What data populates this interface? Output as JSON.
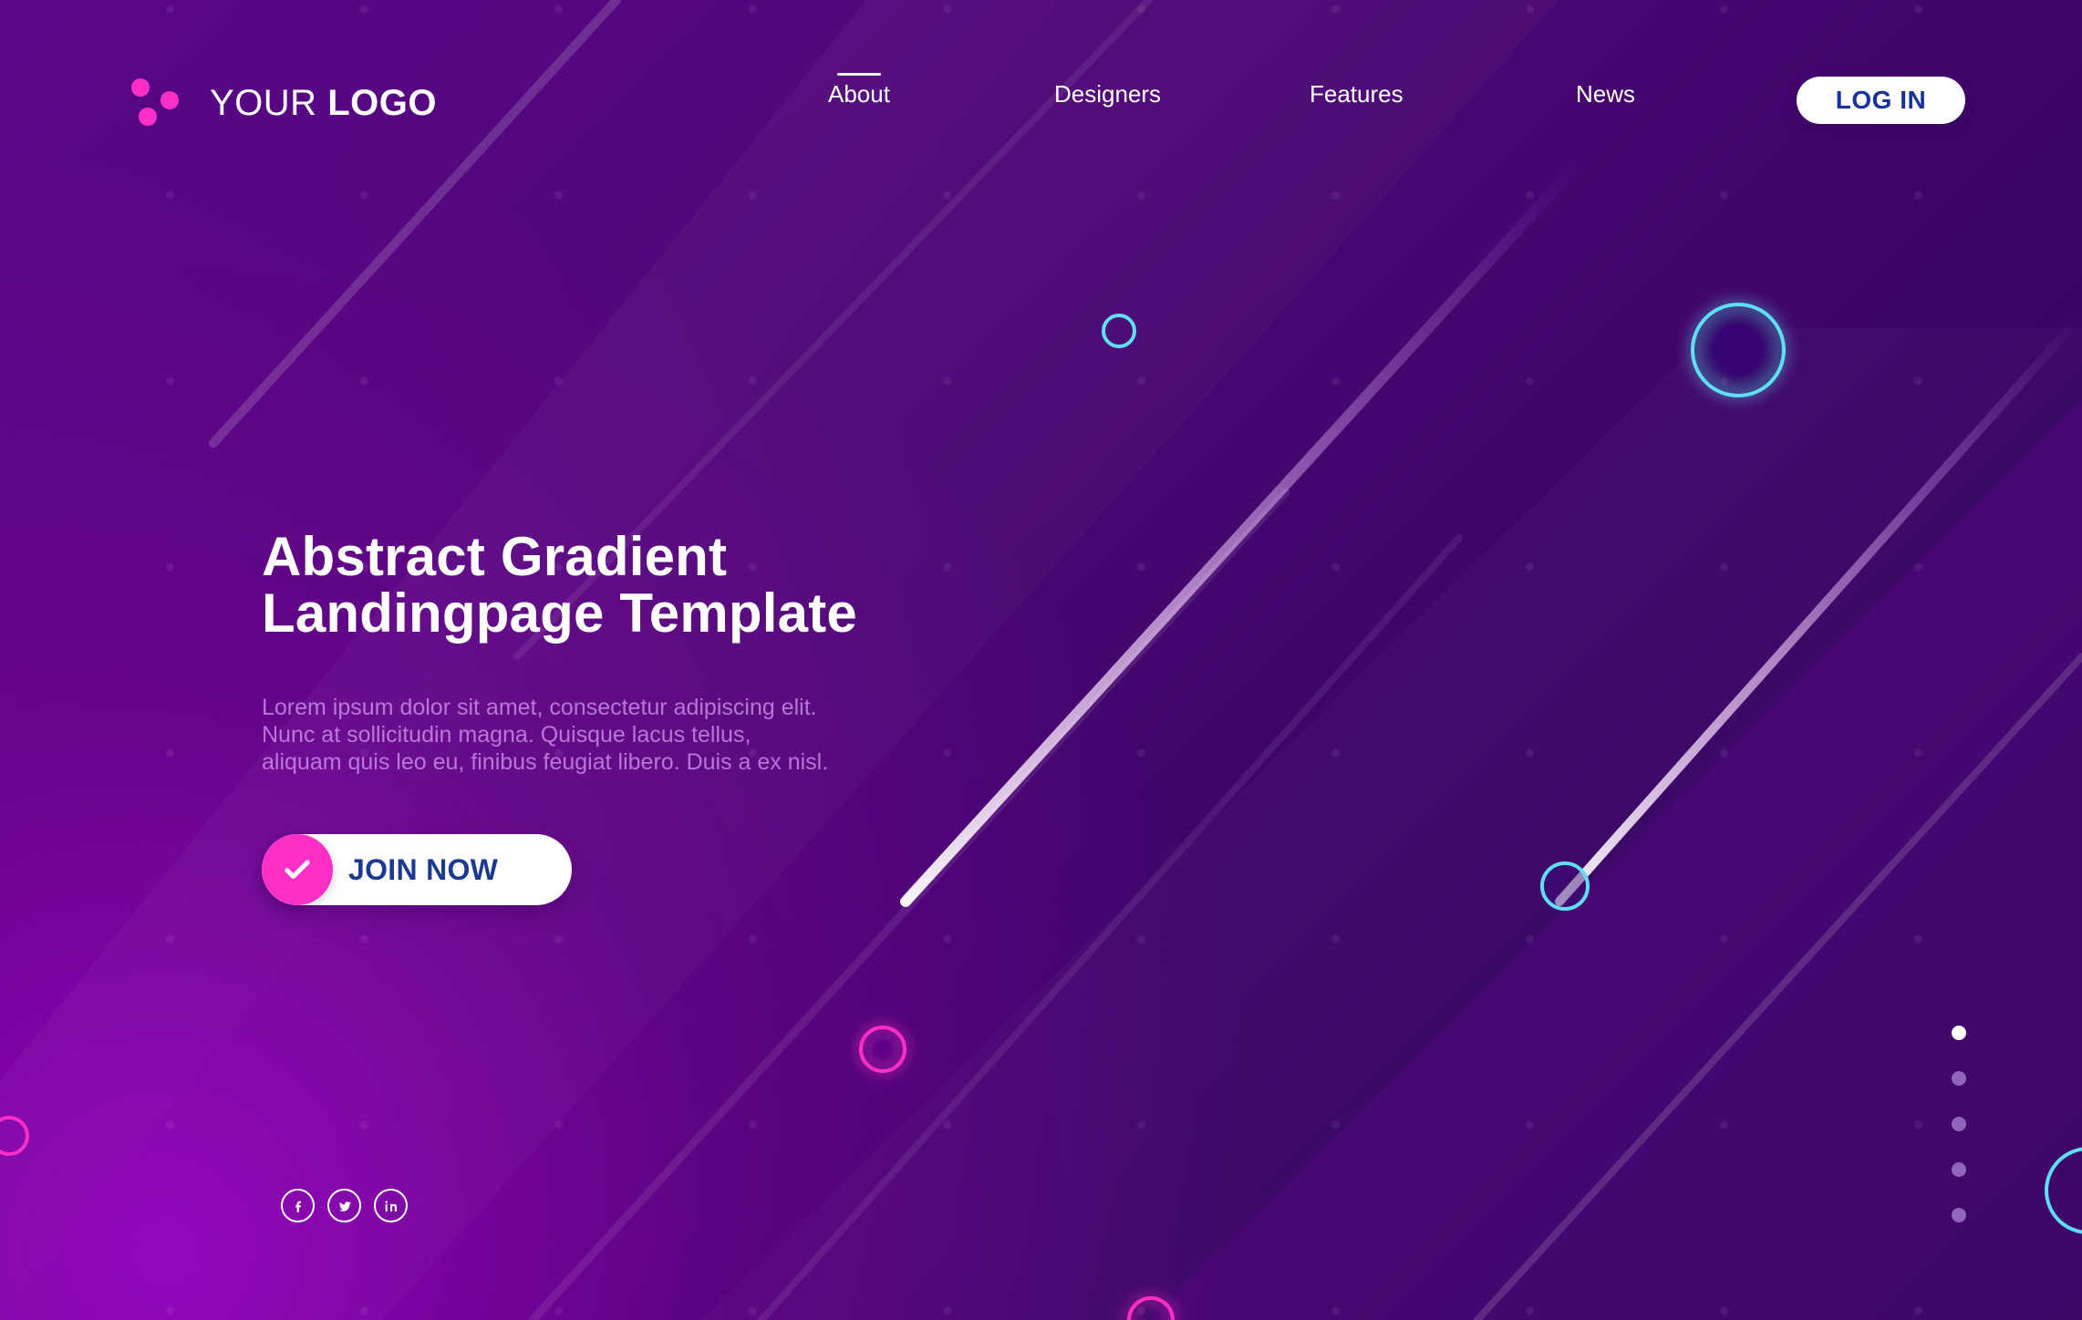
{
  "brand": {
    "logo": {
      "text_light": "YOUR",
      "text_bold": "LOGO"
    }
  },
  "nav": {
    "items": [
      {
        "label": "About",
        "active": true
      },
      {
        "label": "Designers",
        "active": false
      },
      {
        "label": "Features",
        "active": false
      },
      {
        "label": "News",
        "active": false
      }
    ]
  },
  "actions": {
    "login_label": "LOG IN",
    "join_label": "JOIN NOW"
  },
  "hero": {
    "title_lines": [
      "Abstract Gradient",
      "Landingpage Template"
    ],
    "body_lines": [
      "Lorem ipsum dolor sit amet, consectetur adipiscing elit.",
      "Nunc at sollicitudin magna. Quisque lacus tellus,",
      "aliquam quis leo eu, finibus feugiat libero. Duis a ex nisl."
    ]
  },
  "social": {
    "items": [
      {
        "name": "facebook",
        "icon": "facebook-icon"
      },
      {
        "name": "twitter",
        "icon": "twitter-icon"
      },
      {
        "name": "linkedin",
        "icon": "linkedin-icon"
      }
    ]
  },
  "pager": {
    "active_index": 1,
    "count": 5
  },
  "colors": {
    "background_start": "#5b0788",
    "background_end": "#2e0459",
    "accent_pink": "#ff2fc7",
    "accent_cyan": "#5fdff3",
    "button_text": "#16349a",
    "hero_body": "#d6a8ff"
  }
}
